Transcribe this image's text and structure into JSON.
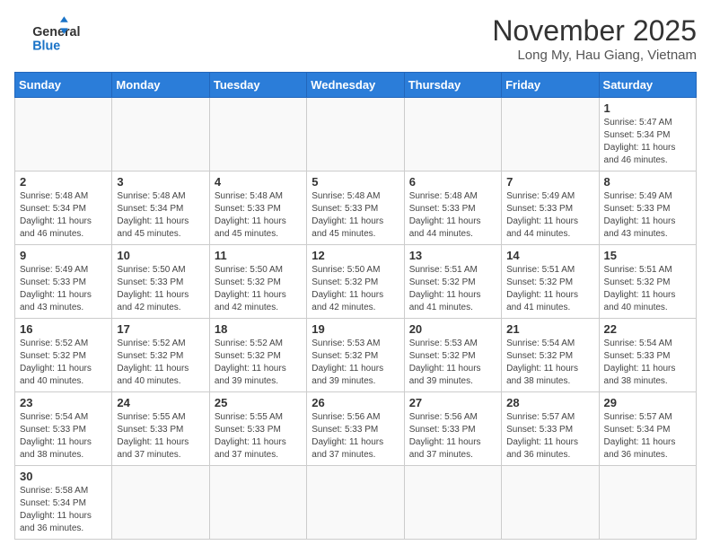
{
  "header": {
    "logo_general": "General",
    "logo_blue": "Blue",
    "month_title": "November 2025",
    "subtitle": "Long My, Hau Giang, Vietnam"
  },
  "days_of_week": [
    "Sunday",
    "Monday",
    "Tuesday",
    "Wednesday",
    "Thursday",
    "Friday",
    "Saturday"
  ],
  "weeks": [
    [
      {
        "day": "",
        "info": ""
      },
      {
        "day": "",
        "info": ""
      },
      {
        "day": "",
        "info": ""
      },
      {
        "day": "",
        "info": ""
      },
      {
        "day": "",
        "info": ""
      },
      {
        "day": "",
        "info": ""
      },
      {
        "day": "1",
        "info": "Sunrise: 5:47 AM\nSunset: 5:34 PM\nDaylight: 11 hours and 46 minutes."
      }
    ],
    [
      {
        "day": "2",
        "info": "Sunrise: 5:48 AM\nSunset: 5:34 PM\nDaylight: 11 hours and 46 minutes."
      },
      {
        "day": "3",
        "info": "Sunrise: 5:48 AM\nSunset: 5:34 PM\nDaylight: 11 hours and 45 minutes."
      },
      {
        "day": "4",
        "info": "Sunrise: 5:48 AM\nSunset: 5:33 PM\nDaylight: 11 hours and 45 minutes."
      },
      {
        "day": "5",
        "info": "Sunrise: 5:48 AM\nSunset: 5:33 PM\nDaylight: 11 hours and 45 minutes."
      },
      {
        "day": "6",
        "info": "Sunrise: 5:48 AM\nSunset: 5:33 PM\nDaylight: 11 hours and 44 minutes."
      },
      {
        "day": "7",
        "info": "Sunrise: 5:49 AM\nSunset: 5:33 PM\nDaylight: 11 hours and 44 minutes."
      },
      {
        "day": "8",
        "info": "Sunrise: 5:49 AM\nSunset: 5:33 PM\nDaylight: 11 hours and 43 minutes."
      }
    ],
    [
      {
        "day": "9",
        "info": "Sunrise: 5:49 AM\nSunset: 5:33 PM\nDaylight: 11 hours and 43 minutes."
      },
      {
        "day": "10",
        "info": "Sunrise: 5:50 AM\nSunset: 5:33 PM\nDaylight: 11 hours and 42 minutes."
      },
      {
        "day": "11",
        "info": "Sunrise: 5:50 AM\nSunset: 5:32 PM\nDaylight: 11 hours and 42 minutes."
      },
      {
        "day": "12",
        "info": "Sunrise: 5:50 AM\nSunset: 5:32 PM\nDaylight: 11 hours and 42 minutes."
      },
      {
        "day": "13",
        "info": "Sunrise: 5:51 AM\nSunset: 5:32 PM\nDaylight: 11 hours and 41 minutes."
      },
      {
        "day": "14",
        "info": "Sunrise: 5:51 AM\nSunset: 5:32 PM\nDaylight: 11 hours and 41 minutes."
      },
      {
        "day": "15",
        "info": "Sunrise: 5:51 AM\nSunset: 5:32 PM\nDaylight: 11 hours and 40 minutes."
      }
    ],
    [
      {
        "day": "16",
        "info": "Sunrise: 5:52 AM\nSunset: 5:32 PM\nDaylight: 11 hours and 40 minutes."
      },
      {
        "day": "17",
        "info": "Sunrise: 5:52 AM\nSunset: 5:32 PM\nDaylight: 11 hours and 40 minutes."
      },
      {
        "day": "18",
        "info": "Sunrise: 5:52 AM\nSunset: 5:32 PM\nDaylight: 11 hours and 39 minutes."
      },
      {
        "day": "19",
        "info": "Sunrise: 5:53 AM\nSunset: 5:32 PM\nDaylight: 11 hours and 39 minutes."
      },
      {
        "day": "20",
        "info": "Sunrise: 5:53 AM\nSunset: 5:32 PM\nDaylight: 11 hours and 39 minutes."
      },
      {
        "day": "21",
        "info": "Sunrise: 5:54 AM\nSunset: 5:32 PM\nDaylight: 11 hours and 38 minutes."
      },
      {
        "day": "22",
        "info": "Sunrise: 5:54 AM\nSunset: 5:33 PM\nDaylight: 11 hours and 38 minutes."
      }
    ],
    [
      {
        "day": "23",
        "info": "Sunrise: 5:54 AM\nSunset: 5:33 PM\nDaylight: 11 hours and 38 minutes."
      },
      {
        "day": "24",
        "info": "Sunrise: 5:55 AM\nSunset: 5:33 PM\nDaylight: 11 hours and 37 minutes."
      },
      {
        "day": "25",
        "info": "Sunrise: 5:55 AM\nSunset: 5:33 PM\nDaylight: 11 hours and 37 minutes."
      },
      {
        "day": "26",
        "info": "Sunrise: 5:56 AM\nSunset: 5:33 PM\nDaylight: 11 hours and 37 minutes."
      },
      {
        "day": "27",
        "info": "Sunrise: 5:56 AM\nSunset: 5:33 PM\nDaylight: 11 hours and 37 minutes."
      },
      {
        "day": "28",
        "info": "Sunrise: 5:57 AM\nSunset: 5:33 PM\nDaylight: 11 hours and 36 minutes."
      },
      {
        "day": "29",
        "info": "Sunrise: 5:57 AM\nSunset: 5:34 PM\nDaylight: 11 hours and 36 minutes."
      }
    ],
    [
      {
        "day": "30",
        "info": "Sunrise: 5:58 AM\nSunset: 5:34 PM\nDaylight: 11 hours and 36 minutes."
      },
      {
        "day": "",
        "info": ""
      },
      {
        "day": "",
        "info": ""
      },
      {
        "day": "",
        "info": ""
      },
      {
        "day": "",
        "info": ""
      },
      {
        "day": "",
        "info": ""
      },
      {
        "day": "",
        "info": ""
      }
    ]
  ]
}
